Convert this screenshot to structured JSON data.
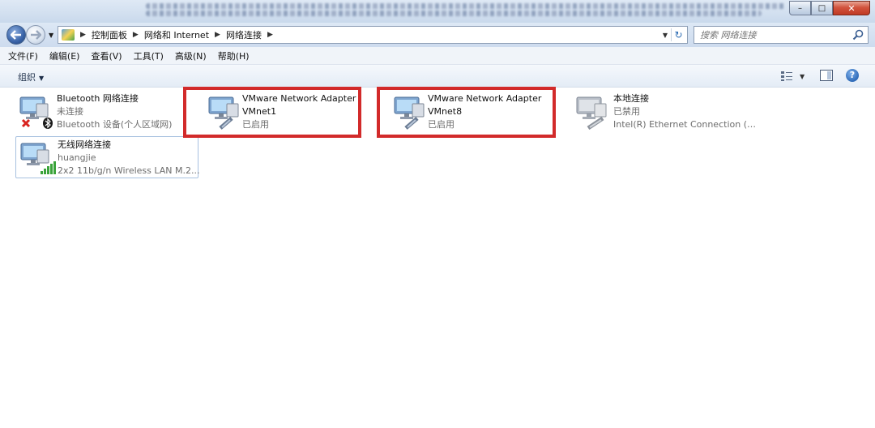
{
  "window": {
    "minimize_glyph": "–",
    "maximize_glyph": "□",
    "close_glyph": "✕"
  },
  "address": {
    "breadcrumbs": [
      "控制面板",
      "网络和 Internet",
      "网络连接"
    ],
    "refresh_glyph": "↻",
    "search_placeholder": "搜索 网络连接"
  },
  "menu": [
    "文件(F)",
    "编辑(E)",
    "查看(V)",
    "工具(T)",
    "高级(N)",
    "帮助(H)"
  ],
  "toolbar": {
    "organize_label": "组织",
    "help_glyph": "?"
  },
  "connections": [
    {
      "name": "Bluetooth 网络连接",
      "status": "未连接",
      "device": "Bluetooth 设备(个人区域网)",
      "icon": "bluetooth-network-icon"
    },
    {
      "name": "VMware Network Adapter",
      "name2": "VMnet1",
      "status": "已启用",
      "icon": "ethernet-adapter-icon"
    },
    {
      "name": "VMware Network Adapter",
      "name2": "VMnet8",
      "status": "已启用",
      "icon": "ethernet-adapter-icon"
    },
    {
      "name": "本地连接",
      "status": "已禁用",
      "device": "Intel(R) Ethernet Connection (3...",
      "icon": "local-area-connection-icon"
    },
    {
      "name": "无线网络连接",
      "status": "huangjie",
      "device": "2x2 11b/g/n Wireless LAN M.2...",
      "icon": "wireless-network-icon"
    }
  ],
  "colors": {
    "highlight_border": "#d22a2a",
    "selection_border": "#a8c1e0",
    "status_text": "#6c6c6c"
  }
}
